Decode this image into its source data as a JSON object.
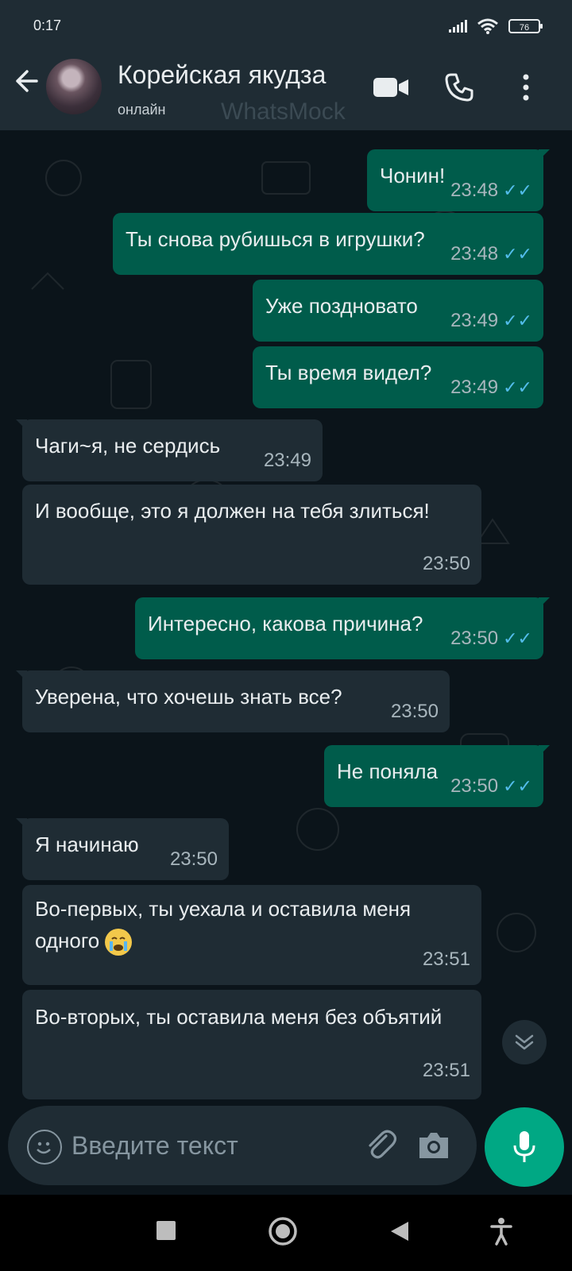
{
  "status_bar": {
    "time": "0:17",
    "battery": "76"
  },
  "header": {
    "title": "Корейская якудза",
    "status": "онлайн",
    "watermark": "WhatsMock"
  },
  "messages": [
    {
      "dir": "out",
      "text": "Чонин!",
      "time": "23:48"
    },
    {
      "dir": "out",
      "text": "Ты снова рубишься в игрушки?",
      "time": "23:48"
    },
    {
      "dir": "out",
      "text": "Уже поздновато",
      "time": "23:49"
    },
    {
      "dir": "out",
      "text": "Ты время видел?",
      "time": "23:49"
    },
    {
      "dir": "in",
      "text": "Чаги~я, не сердись",
      "time": "23:49"
    },
    {
      "dir": "in",
      "text": "И вообще, это я должен на тебя злиться!",
      "time": "23:50"
    },
    {
      "dir": "out",
      "text": "Интересно, какова причина?",
      "time": "23:50"
    },
    {
      "dir": "in",
      "text": "Уверена, что хочешь знать все?",
      "time": "23:50"
    },
    {
      "dir": "out",
      "text": "Не поняла",
      "time": "23:50"
    },
    {
      "dir": "in",
      "text": "Я начинаю",
      "time": "23:50"
    },
    {
      "dir": "in",
      "text": "Во-первых, ты уехала и оставила меня одного",
      "time": "23:51",
      "emoji": "crying-face"
    },
    {
      "dir": "in",
      "text": "Во-вторых, ты оставила меня без объятий",
      "time": "23:51"
    }
  ],
  "composer": {
    "placeholder": "Введите текст"
  },
  "colors": {
    "header_bg": "#1f2c34",
    "chat_bg": "#0b141a",
    "outgoing_bubble": "#005c4b",
    "incoming_bubble": "#1f2c34",
    "read_ticks": "#53bdeb",
    "mic_button": "#00a884"
  },
  "icons": {
    "back": "arrow-left-icon",
    "video": "video-camera-icon",
    "call": "phone-icon",
    "menu": "more-vertical-icon",
    "emoji": "emoji-icon",
    "attach": "paperclip-icon",
    "camera": "camera-icon",
    "mic": "microphone-icon",
    "scroll": "chevron-double-down-icon"
  }
}
